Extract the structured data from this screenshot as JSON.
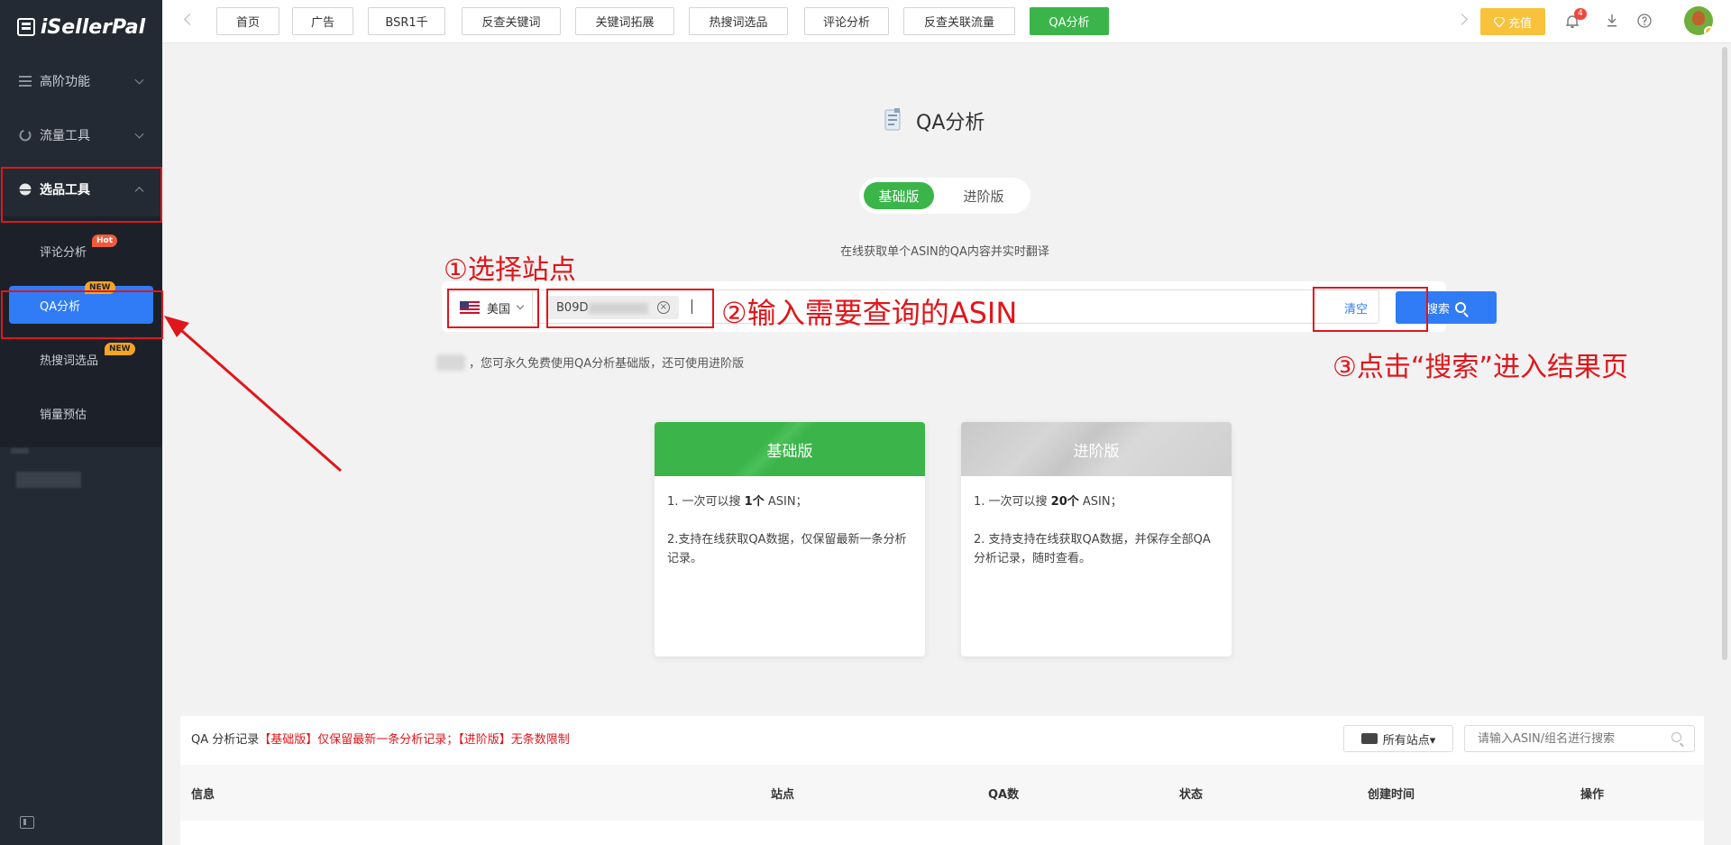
{
  "sidebar": {
    "logo": "iSellerPal",
    "groups": [
      {
        "label": "高阶功能"
      },
      {
        "label": "流量工具"
      },
      {
        "label": "选品工具"
      }
    ],
    "sub_items": [
      {
        "label": "评论分析",
        "badge": "Hot"
      },
      {
        "label": "QA分析",
        "badge": "NEW"
      },
      {
        "label": "热搜词选品",
        "badge": "NEW"
      },
      {
        "label": "销量预估"
      }
    ]
  },
  "topbar": {
    "tabs": [
      "首页",
      "广告",
      "BSR1千",
      "反查关键词",
      "关键词拓展",
      "热搜词选品",
      "评论分析",
      "反查关联流量",
      "QA分析"
    ],
    "recharge": "充值",
    "notifications": "4"
  },
  "main": {
    "title": "QA分析",
    "toggle": {
      "basic": "基础版",
      "advanced": "进阶版"
    },
    "subtitle": "在线获取单个ASIN的QA内容并实时翻译",
    "country": "美国",
    "asin_chip": "B09D",
    "clear": "清空",
    "search": "搜索",
    "note": "，您可永久免费使用QA分析基础版，还可使用进阶版"
  },
  "annotations": {
    "step1": "①选择站点",
    "step2": "②输入需要查询的ASIN",
    "step3": "③点击“搜索”进入结果页"
  },
  "cards": {
    "basic": {
      "title": "基础版",
      "line1_pre": "1. 一次可以搜 ",
      "line1_bold": "1个",
      "line1_post": " ASIN；",
      "line2": "2.支持在线获取QA数据，仅保留最新一条分析记录。"
    },
    "advanced": {
      "title": "进阶版",
      "line1_pre": "1. 一次可以搜 ",
      "line1_bold": "20个",
      "line1_post": " ASIN；",
      "line2": "2. 支持支持在线获取QA数据，并保存全部QA分析记录，随时查看。"
    }
  },
  "records": {
    "title": "QA 分析记录",
    "note": "【基础版】仅保留最新一条分析记录；【进阶版】无条数限制",
    "site_filter": "所有站点▾",
    "search_placeholder": "请输入ASIN/组名进行搜索",
    "columns": [
      "信息",
      "站点",
      "QA数",
      "状态",
      "创建时间",
      "操作"
    ]
  },
  "colors": {
    "sidebar": "#232a33",
    "primary_blue": "#2f7cf6",
    "green": "#3bb54a",
    "annotation_red": "#e0161b"
  }
}
